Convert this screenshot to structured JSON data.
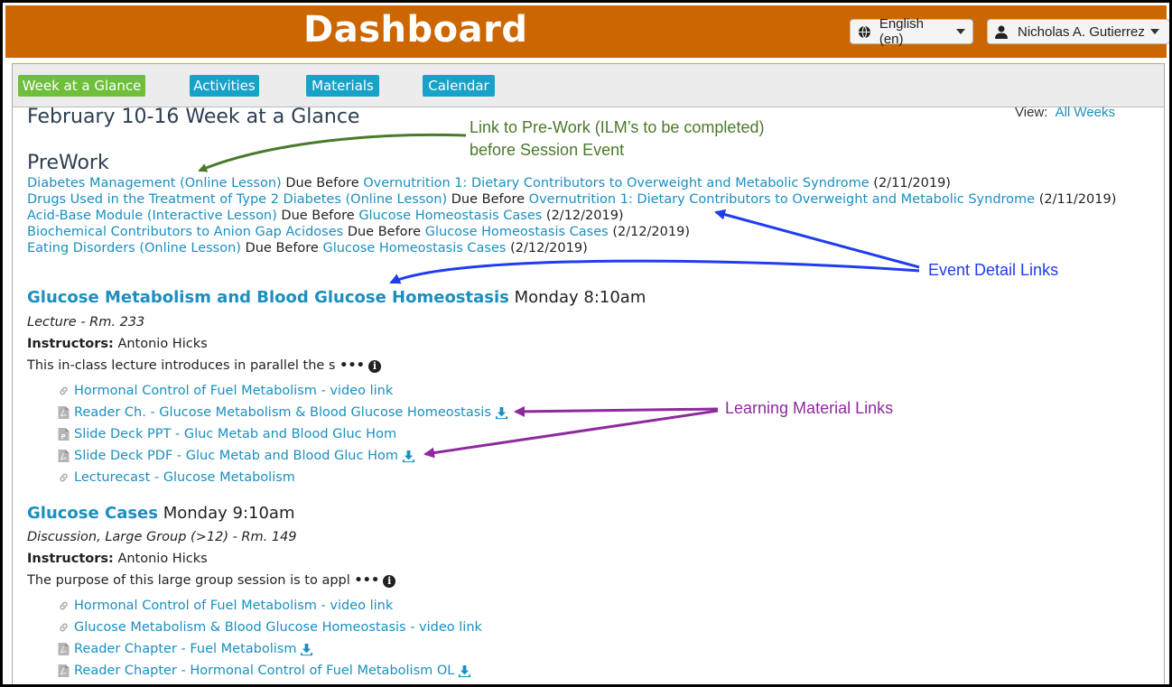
{
  "header": {
    "title": "Dashboard",
    "language": "English (en)",
    "user": "Nicholas A. Gutierrez",
    "bar_color": "#cc6600"
  },
  "tabs": [
    {
      "label": "Week at a Glance",
      "active": true
    },
    {
      "label": "Activities",
      "active": false
    },
    {
      "label": "Materials",
      "active": false
    },
    {
      "label": "Calendar",
      "active": false
    }
  ],
  "week": {
    "heading": "February 10-16 Week at a Glance",
    "view_label": "View:",
    "view_link": "All Weeks"
  },
  "prework": {
    "heading": "PreWork",
    "items": [
      {
        "lesson": "Diabetes Management (Online Lesson)",
        "due": "Due Before",
        "event": "Overnutrition 1: Dietary Contributors to Overweight and Metabolic Syndrome",
        "date": "(2/11/2019)"
      },
      {
        "lesson": "Drugs Used in the Treatment of Type 2 Diabetes (Online Lesson)",
        "due": "Due Before",
        "event": "Overnutrition 1: Dietary Contributors to Overweight and Metabolic Syndrome",
        "date": "(2/11/2019)"
      },
      {
        "lesson": "Acid-Base Module (Interactive Lesson)",
        "due": "Due Before",
        "event": "Glucose Homeostasis Cases",
        "date": "(2/12/2019)"
      },
      {
        "lesson": "Biochemical Contributors to Anion Gap Acidoses",
        "due": "Due Before",
        "event": "Glucose Homeostasis Cases",
        "date": "(2/12/2019)"
      },
      {
        "lesson": "Eating Disorders (Online Lesson)",
        "due": "Due Before",
        "event": "Glucose Homeostasis Cases",
        "date": "(2/12/2019)"
      }
    ]
  },
  "events": [
    {
      "title": "Glucose Metabolism and Blood Glucose Homeostasis",
      "time": "Monday 8:10am",
      "type": "Lecture - Rm. 233",
      "instructors_label": "Instructors:",
      "instructors": "Antonio Hicks",
      "description": "This in-class lecture introduces in parallel the s",
      "more": "•••",
      "materials": [
        {
          "icon": "link-icon",
          "label": "Hormonal Control of Fuel Metabolism - video link",
          "download": false
        },
        {
          "icon": "pdf-file-icon",
          "label": "Reader Ch. - Glucose Metabolism & Blood Glucose Homeostasis",
          "download": true
        },
        {
          "icon": "ppt-file-icon",
          "label": "Slide Deck PPT - Gluc Metab and Blood Gluc Hom",
          "download": false
        },
        {
          "icon": "pdf-file-icon",
          "label": "Slide Deck PDF - Gluc Metab and Blood Gluc Hom",
          "download": true
        },
        {
          "icon": "link-icon",
          "label": "Lecturecast - Glucose Metabolism",
          "download": false
        }
      ]
    },
    {
      "title": "Glucose Cases",
      "time": "Monday 9:10am",
      "type": "Discussion, Large Group (>12) - Rm. 149",
      "instructors_label": "Instructors:",
      "instructors": "Antonio Hicks",
      "description": "The purpose of this large group session is to appl",
      "more": "•••",
      "materials": [
        {
          "icon": "link-icon",
          "label": "Hormonal Control of Fuel Metabolism - video link",
          "download": false
        },
        {
          "icon": "link-icon",
          "label": "Glucose Metabolism & Blood Glucose Homeostasis - video link",
          "download": false
        },
        {
          "icon": "pdf-file-icon",
          "label": "Reader Chapter - Fuel Metabolism",
          "download": true
        },
        {
          "icon": "pdf-file-icon",
          "label": "Reader Chapter - Hormonal Control of Fuel Metabolism OL",
          "download": true
        }
      ]
    }
  ],
  "annotations": {
    "prework_line1": "Link to Pre-Work (ILM’s to be completed)",
    "prework_line2": "before Session Event",
    "event_links": "Event Detail Links",
    "material_links": "Learning Material Links",
    "prework_color": "#4a7a2a",
    "event_color": "#1f3cf0",
    "material_color": "#8e2a9e"
  }
}
